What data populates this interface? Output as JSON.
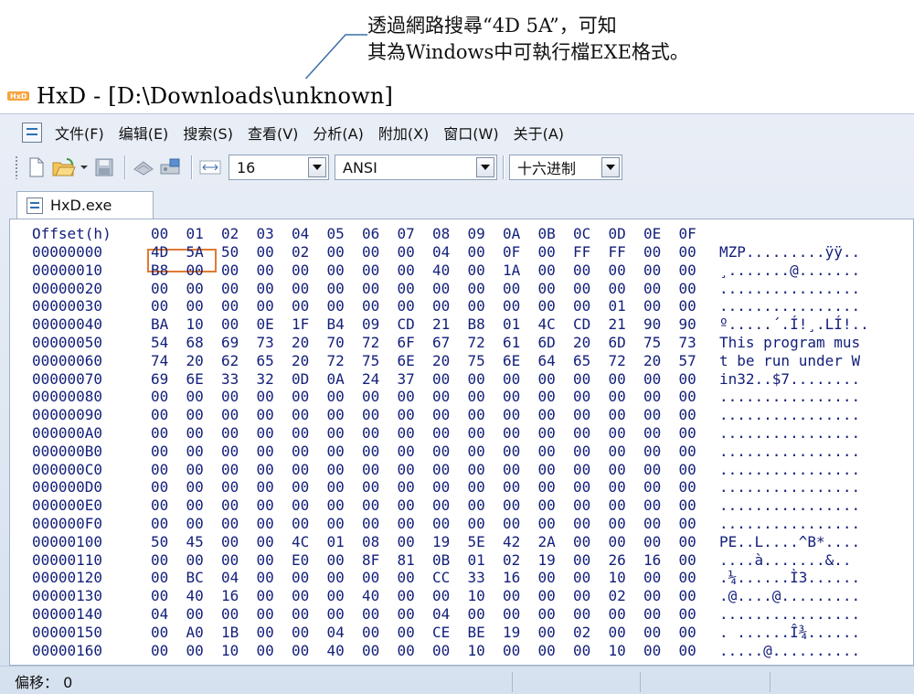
{
  "annotation": {
    "line1": "透過網路搜尋“4D 5A”，可知",
    "line2": "其為Windows中可執行檔EXE格式。"
  },
  "window": {
    "title": "HxD - [D:\\Downloads\\unknown]",
    "menu": [
      "文件(F)",
      "编辑(E)",
      "搜索(S)",
      "查看(V)",
      "分析(A)",
      "附加(X)",
      "窗口(W)",
      "关于(A)"
    ],
    "toolbar": {
      "bytes_per_row": "16",
      "charset": "ANSI",
      "display_mode": "十六进制"
    },
    "tab_label": "HxD.exe",
    "status": "偏移： 0"
  },
  "hex": {
    "offset_header": "Offset(h)",
    "column_headers": [
      "00",
      "01",
      "02",
      "03",
      "04",
      "05",
      "06",
      "07",
      "08",
      "09",
      "0A",
      "0B",
      "0C",
      "0D",
      "0E",
      "0F"
    ],
    "rows": [
      {
        "offset": "00000000",
        "bytes": [
          "4D",
          "5A",
          "50",
          "00",
          "02",
          "00",
          "00",
          "00",
          "04",
          "00",
          "0F",
          "00",
          "FF",
          "FF",
          "00",
          "00"
        ],
        "ascii": "MZP.........ÿÿ.."
      },
      {
        "offset": "00000010",
        "bytes": [
          "B8",
          "00",
          "00",
          "00",
          "00",
          "00",
          "00",
          "00",
          "40",
          "00",
          "1A",
          "00",
          "00",
          "00",
          "00",
          "00"
        ],
        "ascii": "¸.......@......."
      },
      {
        "offset": "00000020",
        "bytes": [
          "00",
          "00",
          "00",
          "00",
          "00",
          "00",
          "00",
          "00",
          "00",
          "00",
          "00",
          "00",
          "00",
          "00",
          "00",
          "00"
        ],
        "ascii": "................"
      },
      {
        "offset": "00000030",
        "bytes": [
          "00",
          "00",
          "00",
          "00",
          "00",
          "00",
          "00",
          "00",
          "00",
          "00",
          "00",
          "00",
          "00",
          "01",
          "00",
          "00"
        ],
        "ascii": "................"
      },
      {
        "offset": "00000040",
        "bytes": [
          "BA",
          "10",
          "00",
          "0E",
          "1F",
          "B4",
          "09",
          "CD",
          "21",
          "B8",
          "01",
          "4C",
          "CD",
          "21",
          "90",
          "90"
        ],
        "ascii": "º.....´.Í!¸.LÍ!.."
      },
      {
        "offset": "00000050",
        "bytes": [
          "54",
          "68",
          "69",
          "73",
          "20",
          "70",
          "72",
          "6F",
          "67",
          "72",
          "61",
          "6D",
          "20",
          "6D",
          "75",
          "73"
        ],
        "ascii": "This program mus"
      },
      {
        "offset": "00000060",
        "bytes": [
          "74",
          "20",
          "62",
          "65",
          "20",
          "72",
          "75",
          "6E",
          "20",
          "75",
          "6E",
          "64",
          "65",
          "72",
          "20",
          "57"
        ],
        "ascii": "t be run under W"
      },
      {
        "offset": "00000070",
        "bytes": [
          "69",
          "6E",
          "33",
          "32",
          "0D",
          "0A",
          "24",
          "37",
          "00",
          "00",
          "00",
          "00",
          "00",
          "00",
          "00",
          "00"
        ],
        "ascii": "in32..$7........"
      },
      {
        "offset": "00000080",
        "bytes": [
          "00",
          "00",
          "00",
          "00",
          "00",
          "00",
          "00",
          "00",
          "00",
          "00",
          "00",
          "00",
          "00",
          "00",
          "00",
          "00"
        ],
        "ascii": "................"
      },
      {
        "offset": "00000090",
        "bytes": [
          "00",
          "00",
          "00",
          "00",
          "00",
          "00",
          "00",
          "00",
          "00",
          "00",
          "00",
          "00",
          "00",
          "00",
          "00",
          "00"
        ],
        "ascii": "................"
      },
      {
        "offset": "000000A0",
        "bytes": [
          "00",
          "00",
          "00",
          "00",
          "00",
          "00",
          "00",
          "00",
          "00",
          "00",
          "00",
          "00",
          "00",
          "00",
          "00",
          "00"
        ],
        "ascii": "................"
      },
      {
        "offset": "000000B0",
        "bytes": [
          "00",
          "00",
          "00",
          "00",
          "00",
          "00",
          "00",
          "00",
          "00",
          "00",
          "00",
          "00",
          "00",
          "00",
          "00",
          "00"
        ],
        "ascii": "................"
      },
      {
        "offset": "000000C0",
        "bytes": [
          "00",
          "00",
          "00",
          "00",
          "00",
          "00",
          "00",
          "00",
          "00",
          "00",
          "00",
          "00",
          "00",
          "00",
          "00",
          "00"
        ],
        "ascii": "................"
      },
      {
        "offset": "000000D0",
        "bytes": [
          "00",
          "00",
          "00",
          "00",
          "00",
          "00",
          "00",
          "00",
          "00",
          "00",
          "00",
          "00",
          "00",
          "00",
          "00",
          "00"
        ],
        "ascii": "................"
      },
      {
        "offset": "000000E0",
        "bytes": [
          "00",
          "00",
          "00",
          "00",
          "00",
          "00",
          "00",
          "00",
          "00",
          "00",
          "00",
          "00",
          "00",
          "00",
          "00",
          "00"
        ],
        "ascii": "................"
      },
      {
        "offset": "000000F0",
        "bytes": [
          "00",
          "00",
          "00",
          "00",
          "00",
          "00",
          "00",
          "00",
          "00",
          "00",
          "00",
          "00",
          "00",
          "00",
          "00",
          "00"
        ],
        "ascii": "................"
      },
      {
        "offset": "00000100",
        "bytes": [
          "50",
          "45",
          "00",
          "00",
          "4C",
          "01",
          "08",
          "00",
          "19",
          "5E",
          "42",
          "2A",
          "00",
          "00",
          "00",
          "00"
        ],
        "ascii": "PE..L....^B*...."
      },
      {
        "offset": "00000110",
        "bytes": [
          "00",
          "00",
          "00",
          "00",
          "E0",
          "00",
          "8F",
          "81",
          "0B",
          "01",
          "02",
          "19",
          "00",
          "26",
          "16",
          "00"
        ],
        "ascii": "....à.......&.."
      },
      {
        "offset": "00000120",
        "bytes": [
          "00",
          "BC",
          "04",
          "00",
          "00",
          "00",
          "00",
          "00",
          "CC",
          "33",
          "16",
          "00",
          "00",
          "10",
          "00",
          "00"
        ],
        "ascii": ".¼......Ì3......"
      },
      {
        "offset": "00000130",
        "bytes": [
          "00",
          "40",
          "16",
          "00",
          "00",
          "00",
          "40",
          "00",
          "00",
          "10",
          "00",
          "00",
          "00",
          "02",
          "00",
          "00"
        ],
        "ascii": ".@....@........."
      },
      {
        "offset": "00000140",
        "bytes": [
          "04",
          "00",
          "00",
          "00",
          "00",
          "00",
          "00",
          "00",
          "04",
          "00",
          "00",
          "00",
          "00",
          "00",
          "00",
          "00"
        ],
        "ascii": "................"
      },
      {
        "offset": "00000150",
        "bytes": [
          "00",
          "A0",
          "1B",
          "00",
          "00",
          "04",
          "00",
          "00",
          "CE",
          "BE",
          "19",
          "00",
          "02",
          "00",
          "00",
          "00"
        ],
        "ascii": ". ......Î¾......"
      },
      {
        "offset": "00000160",
        "bytes": [
          "00",
          "00",
          "10",
          "00",
          "00",
          "40",
          "00",
          "00",
          "00",
          "10",
          "00",
          "00",
          "00",
          "10",
          "00",
          "00"
        ],
        "ascii": ".....@.........."
      }
    ]
  },
  "colors": {
    "hex_text": "#14207a",
    "highlight_box": "#e07a35",
    "chrome": "#d6e1ef"
  }
}
